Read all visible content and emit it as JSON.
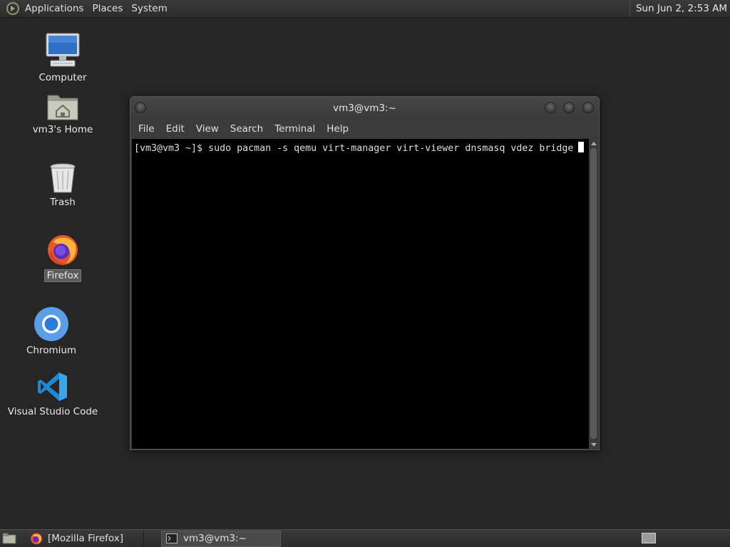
{
  "top_panel": {
    "menus": [
      "Applications",
      "Places",
      "System"
    ],
    "clock": "Sun Jun  2,  2:53 AM"
  },
  "desktop": {
    "icons": [
      {
        "label": "Computer",
        "icon": "computer-icon"
      },
      {
        "label": "vm3's Home",
        "icon": "home-folder-icon"
      },
      {
        "label": "Trash",
        "icon": "trash-icon"
      },
      {
        "label": "Firefox",
        "icon": "firefox-icon"
      },
      {
        "label": "Chromium",
        "icon": "chromium-icon"
      },
      {
        "label": "Visual Studio Code",
        "icon": "vscode-icon"
      }
    ]
  },
  "terminal": {
    "title": "vm3@vm3:~",
    "menus": [
      "File",
      "Edit",
      "View",
      "Search",
      "Terminal",
      "Help"
    ],
    "line": "[vm3@vm3 ~]$ sudo pacman -s qemu virt-manager virt-viewer dnsmasq vdez bridge"
  },
  "taskbar": {
    "tasks": [
      {
        "label": "[Mozilla Firefox]",
        "icon": "firefox-icon",
        "active": false
      },
      {
        "label": "vm3@vm3:~",
        "icon": "terminal-icon",
        "active": true
      }
    ]
  },
  "colors": {
    "desktop_bg": "#262626",
    "panel_bg": "#333333",
    "terminal_bg": "#000000"
  }
}
